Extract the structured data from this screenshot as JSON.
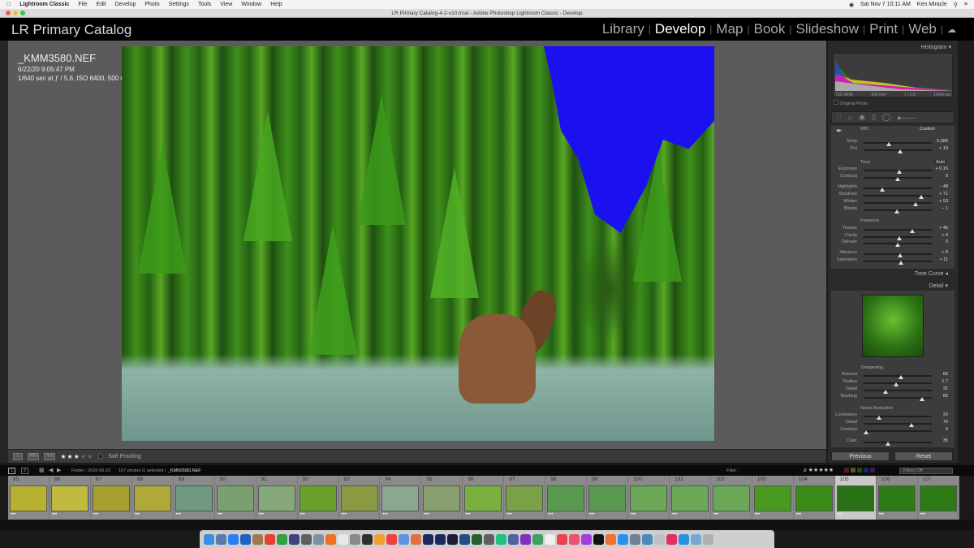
{
  "menubar": {
    "app": "Lightroom Classic",
    "items": [
      "File",
      "Edit",
      "Develop",
      "Photo",
      "Settings",
      "Tools",
      "View",
      "Window",
      "Help"
    ],
    "datetime": "Sat Nov 7  10:11 AM",
    "user": "Ken Miracle"
  },
  "window_title": "LR Primary Catalog-4-2-v10.lrcat - Adobe Photoshop Lightroom Classic - Develop",
  "catalog_name": "LR Primary Catalog",
  "modules": [
    {
      "label": "Library",
      "active": false
    },
    {
      "label": "Develop",
      "active": true
    },
    {
      "label": "Map",
      "active": false
    },
    {
      "label": "Book",
      "active": false
    },
    {
      "label": "Slideshow",
      "active": false
    },
    {
      "label": "Print",
      "active": false
    },
    {
      "label": "Web",
      "active": false
    }
  ],
  "photo_info": {
    "filename": "_KMM3580.NEF",
    "datetime": "6/22/20 9:05:47 PM",
    "exposure": "1/640 sec at ƒ / 5.6, ISO 6400, 500 mm (500.0 mm f/5.6)"
  },
  "toolbar": {
    "rating": 3,
    "max_rating": 5,
    "soft_proofing": "Soft Proofing"
  },
  "histogram": {
    "title": "Histogram",
    "iso": "ISO 6400",
    "focal": "500 mm",
    "aperture": "ƒ / 5.6",
    "shutter": "1/640 sec",
    "original_photo": "Original Photo"
  },
  "basic": {
    "wb_label": "WB :",
    "wb_value": "Custom",
    "tone_label": "Tone",
    "auto": "Auto",
    "presence_label": "Presence",
    "sliders": [
      {
        "label": "Temp",
        "value": "5,586",
        "pos": 0.37
      },
      {
        "label": "Tint",
        "value": "+ 10",
        "pos": 0.53
      },
      {
        "label": "Exposure",
        "value": "+ 0.15",
        "pos": 0.52
      },
      {
        "label": "Contrast",
        "value": "0",
        "pos": 0.5
      },
      {
        "label": "Highlights",
        "value": "− 48",
        "pos": 0.27
      },
      {
        "label": "Shadows",
        "value": "+ 71",
        "pos": 0.85
      },
      {
        "label": "Whites",
        "value": "+ 53",
        "pos": 0.76
      },
      {
        "label": "Blacks",
        "value": "− 1",
        "pos": 0.49
      },
      {
        "label": "Texture",
        "value": "+ 45",
        "pos": 0.72
      },
      {
        "label": "Clarity",
        "value": "+ 4",
        "pos": 0.52
      },
      {
        "label": "Dehaze",
        "value": "0",
        "pos": 0.5
      },
      {
        "label": "Vibrance",
        "value": "+ 8",
        "pos": 0.54
      },
      {
        "label": "Saturation",
        "value": "+ 11",
        "pos": 0.55
      }
    ]
  },
  "tone_curve": {
    "title": "Tone Curve"
  },
  "detail": {
    "title": "Detail",
    "sharpening_label": "Sharpening",
    "noise_label": "Noise Reduction",
    "sliders": [
      {
        "label": "Amount",
        "value": "83",
        "pos": 0.55
      },
      {
        "label": "Radius",
        "value": "1.7",
        "pos": 0.48
      },
      {
        "label": "Detail",
        "value": "31",
        "pos": 0.32
      },
      {
        "label": "Masking",
        "value": "85",
        "pos": 0.86
      },
      {
        "label": "Luminance",
        "value": "20",
        "pos": 0.23
      },
      {
        "label": "Detail",
        "value": "70",
        "pos": 0.7
      },
      {
        "label": "Contrast",
        "value": "0",
        "pos": 0.03
      },
      {
        "label": "Color",
        "value": "35",
        "pos": 0.36
      }
    ]
  },
  "buttons": {
    "previous": "Previous",
    "reset": "Reset"
  },
  "filmstrip": {
    "page1": "1",
    "page2": "2",
    "source": "Folder : 2020-06-22",
    "count": "107 photos /1 selected /",
    "selected_file": "_KMM3580.NEF",
    "filter_label": "Filter :",
    "filter_value": "Filters Off",
    "thumbs": [
      {
        "n": "85",
        "c": "#b8b030"
      },
      {
        "n": "86",
        "c": "#c0bb40"
      },
      {
        "n": "87",
        "c": "#a8a030"
      },
      {
        "n": "88",
        "c": "#b0a838"
      },
      {
        "n": "89",
        "c": "#6f9a80"
      },
      {
        "n": "90",
        "c": "#7aa070"
      },
      {
        "n": "91",
        "c": "#84a878"
      },
      {
        "n": "92",
        "c": "#6aa02a"
      },
      {
        "n": "93",
        "c": "#8a9a40"
      },
      {
        "n": "94",
        "c": "#8aa890"
      },
      {
        "n": "95",
        "c": "#88a070"
      },
      {
        "n": "96",
        "c": "#7ab040"
      },
      {
        "n": "97",
        "c": "#7aa048"
      },
      {
        "n": "98",
        "c": "#5a9a50"
      },
      {
        "n": "99",
        "c": "#5a9a50"
      },
      {
        "n": "100",
        "c": "#6aa858"
      },
      {
        "n": "101",
        "c": "#6aa858"
      },
      {
        "n": "102",
        "c": "#6aa858"
      },
      {
        "n": "103",
        "c": "#4a9a20"
      },
      {
        "n": "104",
        "c": "#3a8a18"
      },
      {
        "n": "105",
        "c": "#2a7014",
        "sel": true
      },
      {
        "n": "106",
        "c": "#2e7a16"
      },
      {
        "n": "107",
        "c": "#2e7a16"
      }
    ]
  },
  "dock_colors": [
    "#3a8ee8",
    "#5a7ab0",
    "#2a80f0",
    "#2060c0",
    "#a07850",
    "#e84030",
    "#30a040",
    "#404080",
    "#606060",
    "#8090a0",
    "#f07020",
    "#e8e8e8",
    "#888",
    "#303030",
    "#f0a030",
    "#f04040",
    "#6090e0",
    "#e07040",
    "#1a2a60",
    "#1a2a60",
    "#1a1a3a",
    "#205080",
    "#2a6030",
    "#606060",
    "#20c080",
    "#5060a0",
    "#8030c0",
    "#40a060",
    "#f0f0f0",
    "#f04050",
    "#f05070",
    "#a040e0",
    "#111",
    "#f07030",
    "#2a90f0",
    "#708090",
    "#4a88c0",
    "#c0c0c0",
    "#e03060",
    "#2a90e0",
    "#78a8d0",
    "#b0b0b0"
  ]
}
